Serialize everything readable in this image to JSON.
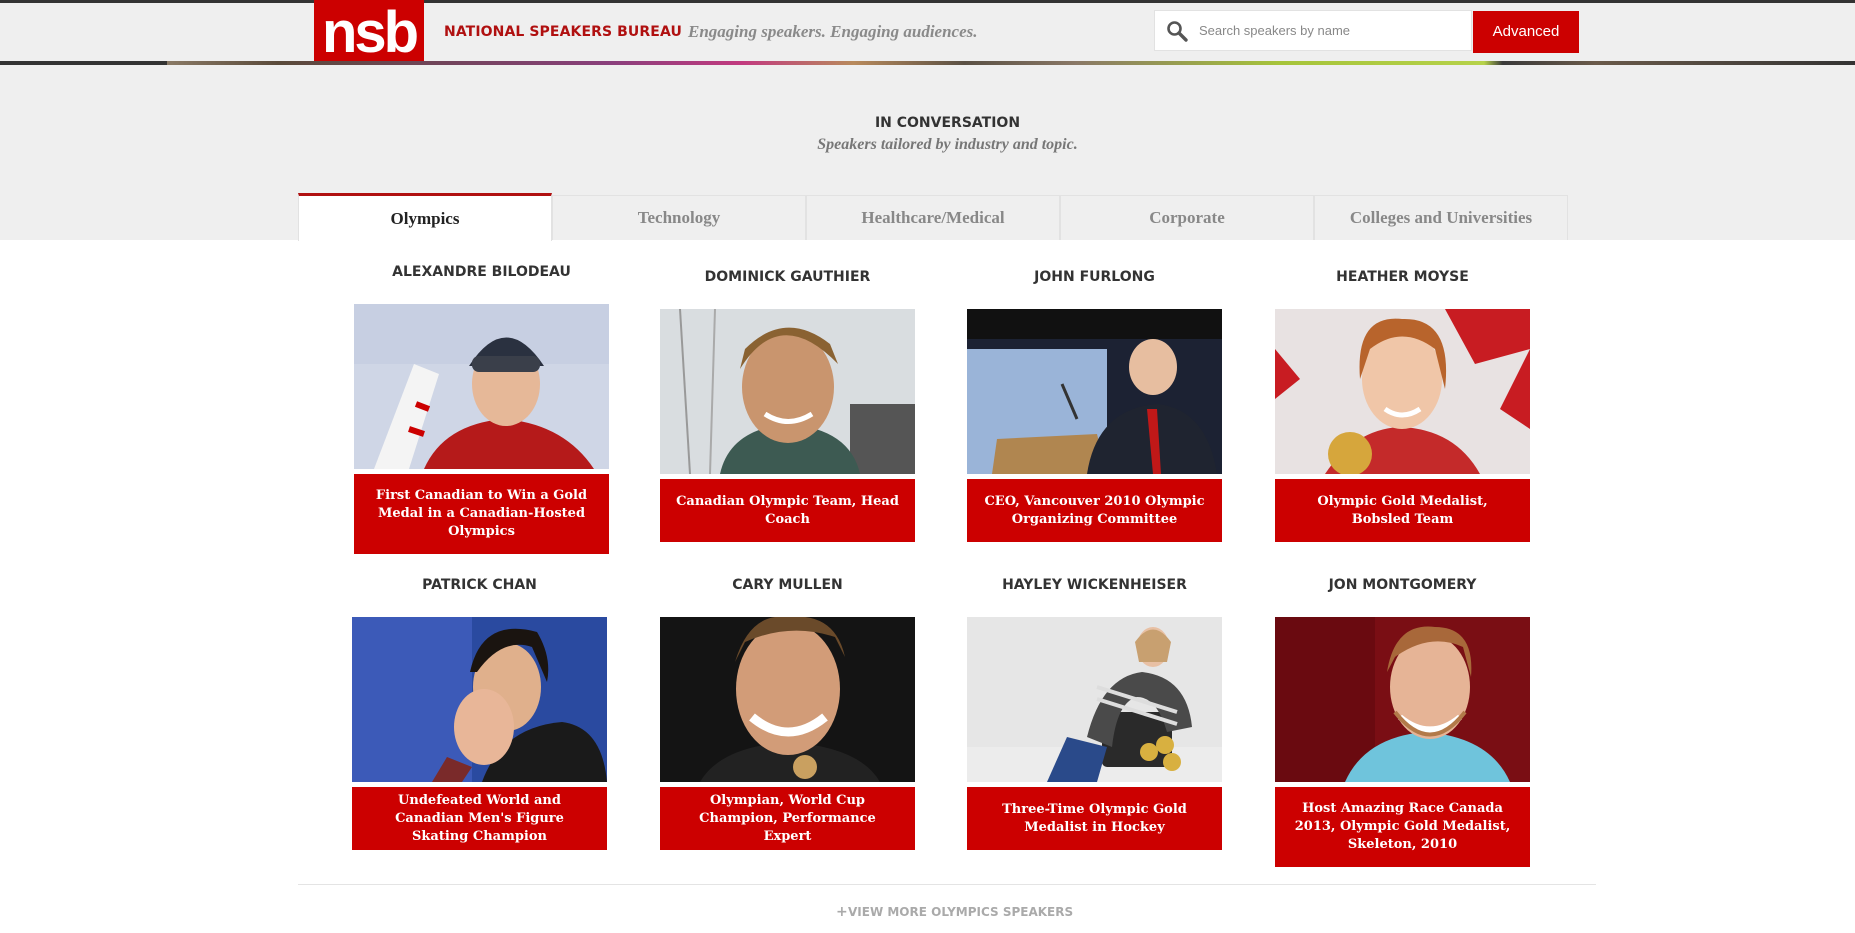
{
  "header": {
    "logo_text": "nsb",
    "brand": "NATIONAL SPEAKERS BUREAU",
    "tagline": "Engaging speakers. Engaging audiences.",
    "search_placeholder": "Search speakers by name",
    "search_value": "",
    "advanced_label": "Advanced",
    "search_icon": "search-icon",
    "brand_color": "#cc0000"
  },
  "intro": {
    "title": "IN CONVERSATION",
    "subtitle": "Speakers tailored by industry and topic."
  },
  "tabs": [
    {
      "label": "Olympics",
      "active": true
    },
    {
      "label": "Technology",
      "active": false
    },
    {
      "label": "Healthcare/Medical",
      "active": false
    },
    {
      "label": "Corporate",
      "active": false
    },
    {
      "label": "Colleges and Universities",
      "active": false
    }
  ],
  "speakers": [
    {
      "name": "ALEXANDRE BILODEAU",
      "caption": "First Canadian to Win a Gold Medal in a Canadian-Hosted Olympics"
    },
    {
      "name": "DOMINICK GAUTHIER",
      "caption": "Canadian Olympic Team, Head Coach"
    },
    {
      "name": "JOHN FURLONG",
      "caption": "CEO, Vancouver 2010 Olympic Organizing Committee"
    },
    {
      "name": "HEATHER MOYSE",
      "caption": "Olympic Gold Medalist, Bobsled Team"
    },
    {
      "name": "PATRICK CHAN",
      "caption": "Undefeated World and Canadian Men's Figure Skating Champion"
    },
    {
      "name": "CARY MULLEN",
      "caption": "Olympian, World Cup Champion, Performance Expert"
    },
    {
      "name": "HAYLEY WICKENHEISER",
      "caption": "Three-Time Olympic Gold Medalist in Hockey"
    },
    {
      "name": "JON MONTGOMERY",
      "caption": "Host Amazing Race Canada 2013, Olympic Gold Medalist, Skeleton, 2010"
    }
  ],
  "footer": {
    "view_more": "VIEW MORE OLYMPICS SPEAKERS",
    "view_more_icon": "plus-icon"
  }
}
